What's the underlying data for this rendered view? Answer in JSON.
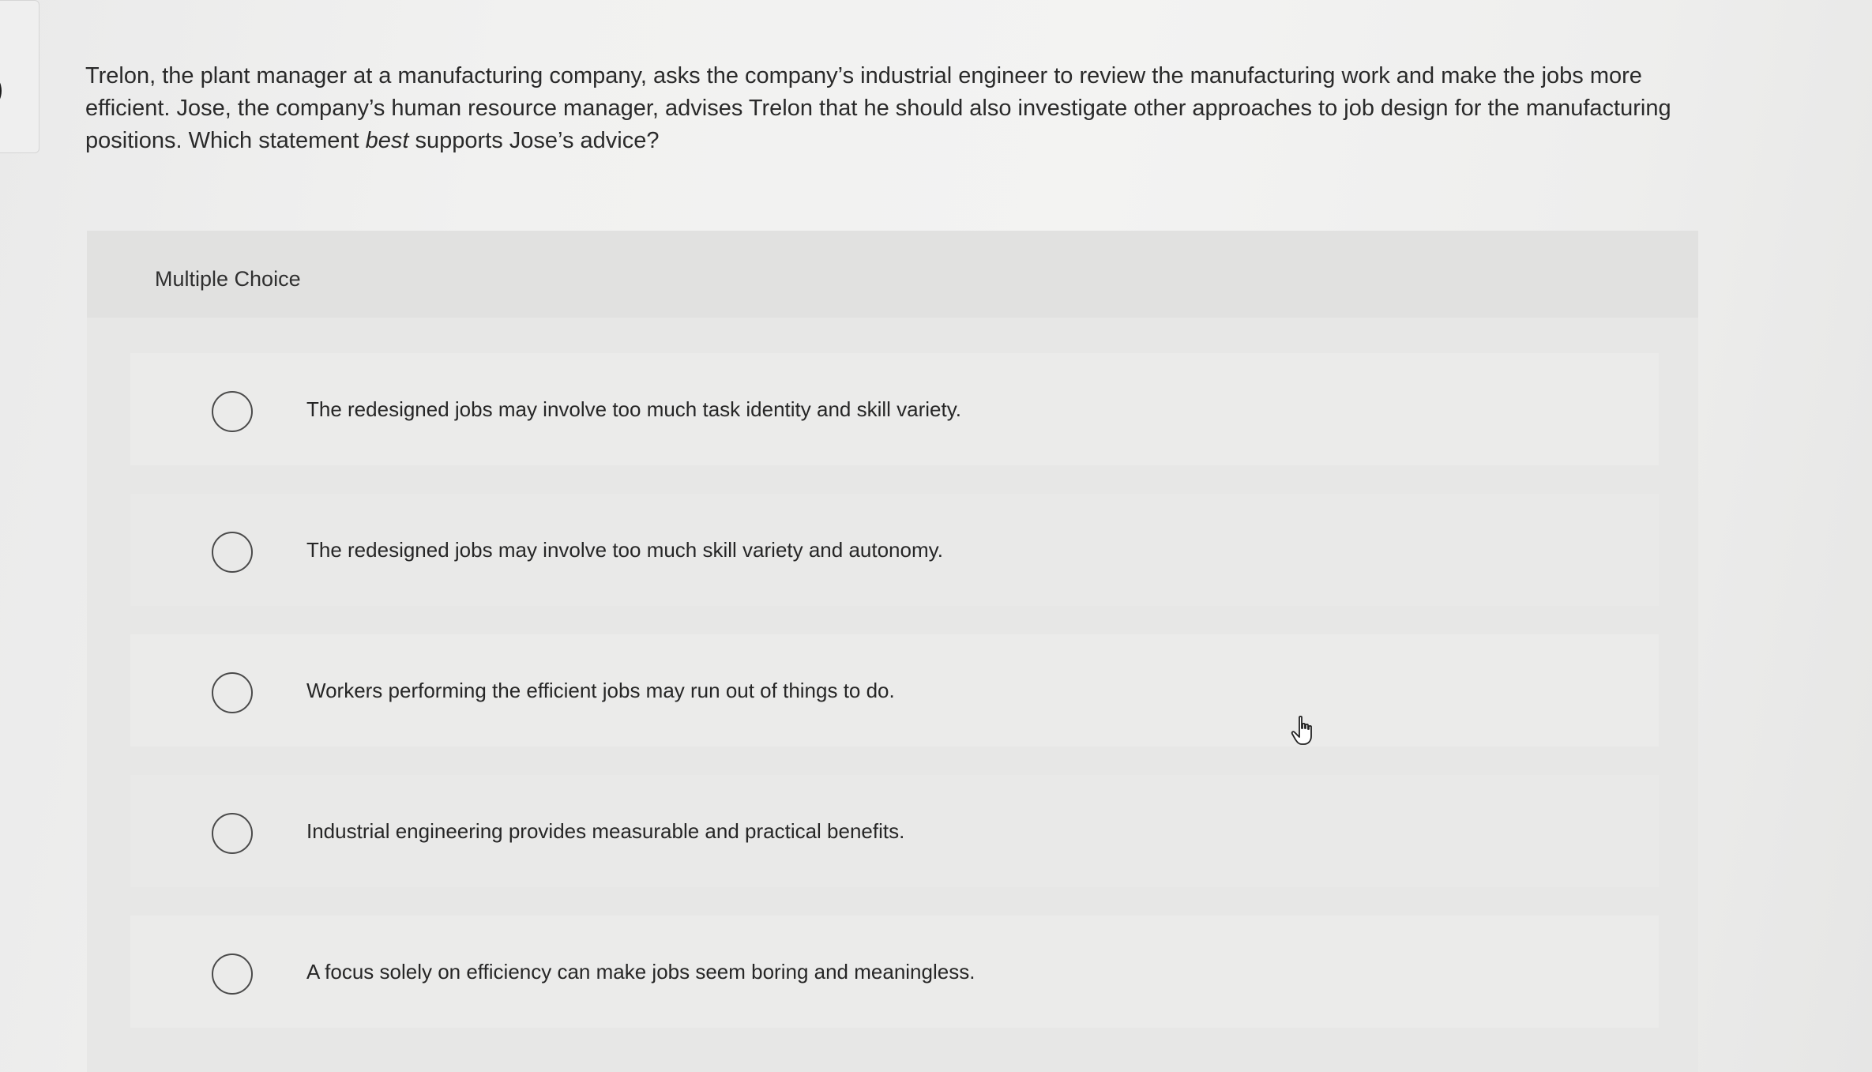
{
  "question": {
    "text_before": "Trelon, the plant manager at a manufacturing company, asks the company’s industrial engineer to review the manufacturing work and make the jobs more efficient. Jose, the company’s human resource manager, advises Trelon that he should also investigate other approaches to job design for the manufacturing positions. Which statement ",
    "emphasis": "best",
    "text_after": " supports Jose’s advice?"
  },
  "multiple_choice": {
    "label": "Multiple Choice",
    "options": [
      {
        "label": "The redesigned jobs may involve too much task identity and skill variety.",
        "selected": false
      },
      {
        "label": "The redesigned jobs may involve too much skill variety and autonomy.",
        "selected": false
      },
      {
        "label": "Workers performing the efficient jobs may run out of things to do.",
        "selected": false
      },
      {
        "label": "Industrial engineering provides measurable and practical benefits.",
        "selected": false
      },
      {
        "label": "A focus solely on efficiency can make jobs seem boring and meaningless.",
        "selected": false
      }
    ]
  },
  "icons": {
    "cursor": "hand-pointer-icon",
    "radio": "radio-unselected-icon"
  },
  "colors": {
    "page_background": "#f1f1f0",
    "panel_background": "#e7e7e6",
    "text": "#2a2a2a"
  }
}
